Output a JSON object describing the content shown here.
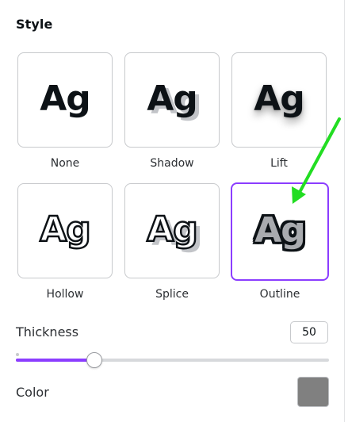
{
  "section": {
    "title": "Style"
  },
  "styles": [
    {
      "id": "none",
      "preview": "Ag",
      "label": "None",
      "selected": false
    },
    {
      "id": "shadow",
      "preview": "Ag",
      "label": "Shadow",
      "selected": false
    },
    {
      "id": "lift",
      "preview": "Ag",
      "label": "Lift",
      "selected": false
    },
    {
      "id": "hollow",
      "preview": "Ag",
      "label": "Hollow",
      "selected": false
    },
    {
      "id": "splice",
      "preview": "Ag",
      "label": "Splice",
      "selected": false
    },
    {
      "id": "outline",
      "preview": "Ag",
      "label": "Outline",
      "selected": true
    }
  ],
  "thickness": {
    "label": "Thickness",
    "value": "50",
    "fraction": 0.25
  },
  "color": {
    "label": "Color",
    "swatch": "#808080"
  },
  "accent": "#8b3dff",
  "annotation": {
    "arrow_color": "#22dd22"
  }
}
